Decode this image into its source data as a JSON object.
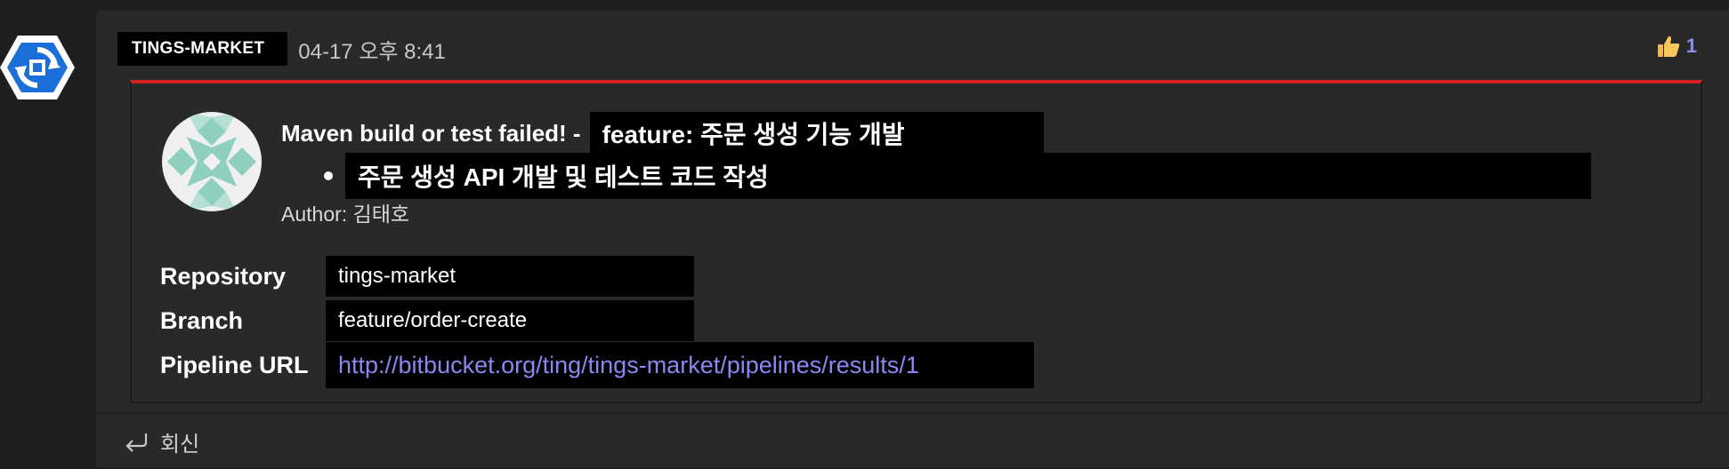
{
  "app": {
    "icon": "pipelines-app-icon"
  },
  "post": {
    "sender": "TINGS-MARKET",
    "timestamp": "04-17 오후 8:41",
    "reaction": {
      "icon": "thumbs-up-icon",
      "count": "1"
    },
    "card": {
      "accent_color": "#d42020",
      "title_static": "Maven build or test failed! -",
      "title_branch_label": "feature: 주문 생성 기능 개발",
      "bullet": "주문 생성 API 개발 및 테스트 코드 작성",
      "author_label": "Author: 김태호",
      "facts": [
        {
          "key": "Repository",
          "value": "tings-market"
        },
        {
          "key": "Branch",
          "value": "feature/order-create"
        },
        {
          "key": "Pipeline URL",
          "value": "http://bitbucket.org/ting/tings-market/pipelines/results/1"
        }
      ]
    },
    "reply_label": "회신"
  }
}
